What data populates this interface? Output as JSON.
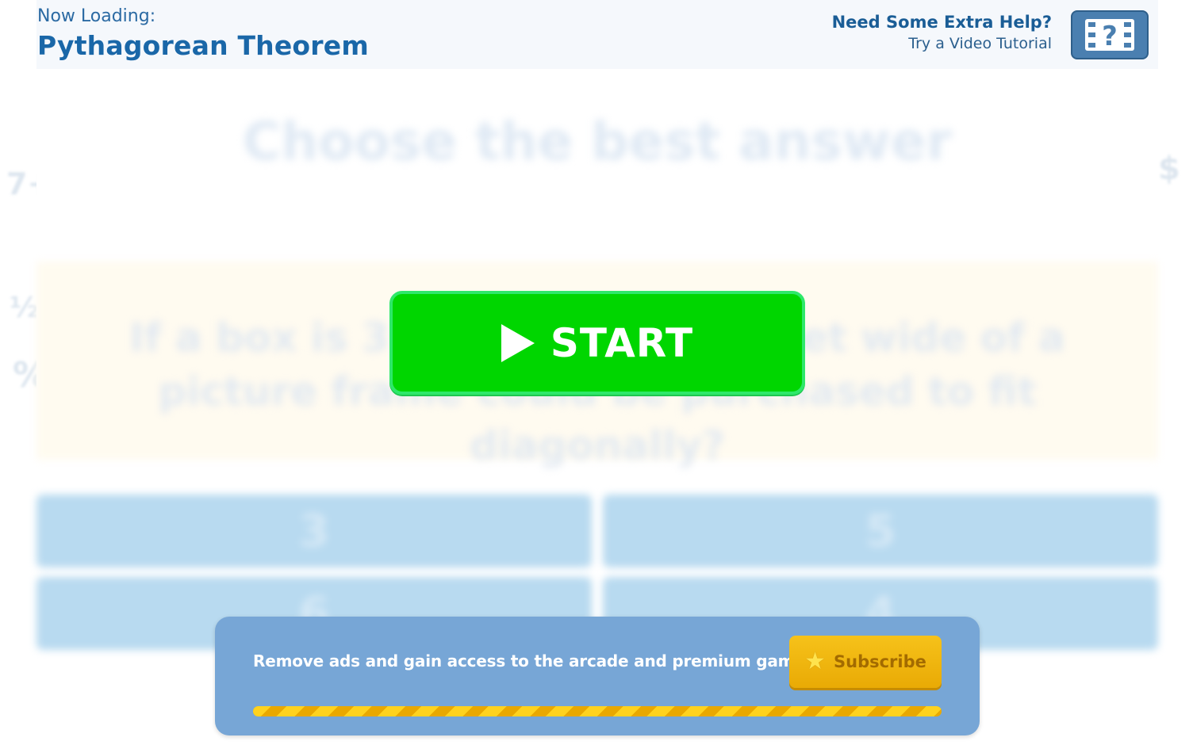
{
  "header": {
    "loading_label": "Now Loading:",
    "game_title": "Pythagorean Theorem",
    "help_title": "Need Some Extra Help?",
    "help_subtitle": "Try a Video Tutorial",
    "video_icon": "video-tutorial-icon"
  },
  "background_question": {
    "heading": "Choose the best answer",
    "prompt": "If a box is 3 feet long and 4 feet wide of a picture frame could be purchased to fit diagonally?",
    "answers": [
      "3",
      "5",
      "6",
      "4"
    ]
  },
  "start_button": {
    "label": "START",
    "icon": "play-icon"
  },
  "subscribe_banner": {
    "message": "Remove ads and gain access to the arcade and premium games!",
    "button_label": "Subscribe",
    "button_icon": "star-icon",
    "progress": 1.0
  },
  "colors": {
    "start_green": "#00d600",
    "banner_blue": "#77a6d6",
    "subscribe_gold": "#f6c21a",
    "title_blue": "#1a67a8"
  }
}
